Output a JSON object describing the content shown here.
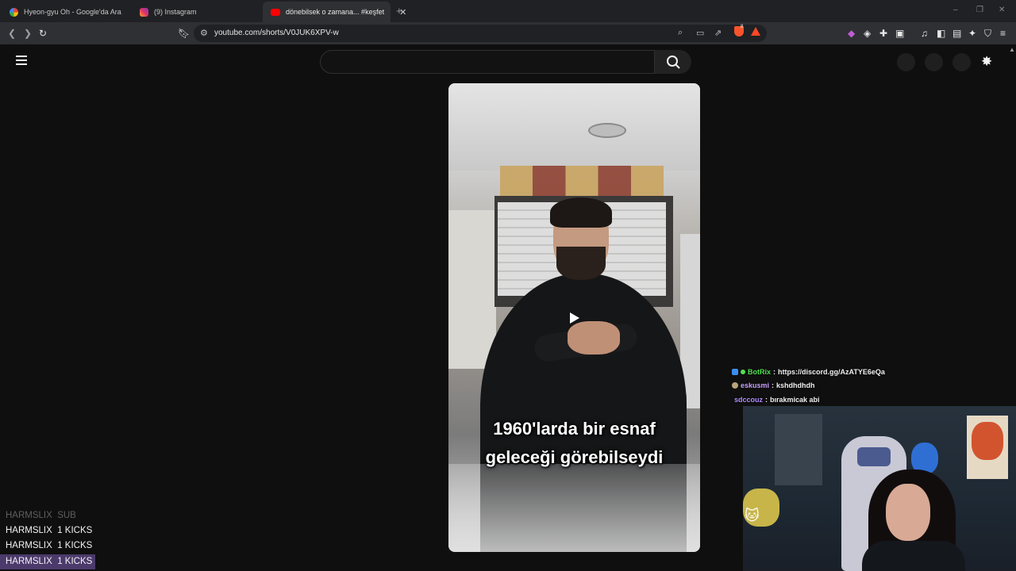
{
  "browser": {
    "tabs": [
      {
        "title": "Hyeon-gyu Oh - Google'da Ara",
        "icon": "google-icon",
        "active": false
      },
      {
        "title": "(9) Instagram",
        "icon": "instagram-icon",
        "active": false
      },
      {
        "title": "dönebilsek o zamana... #keşfet",
        "icon": "youtube-icon",
        "active": true
      }
    ],
    "new_tab": "+",
    "url": "youtube.com/shorts/V0JUK6XPV-w",
    "window_controls": [
      "–",
      "❐",
      "✕"
    ],
    "brave_badge": "8"
  },
  "youtube": {
    "search_placeholder": "",
    "video": {
      "caption_line1": "1960'larda bir esnaf",
      "caption_line2": "geleceği görebilseydi"
    }
  },
  "stream": {
    "chat": [
      {
        "user": "BotRix",
        "message": "https://discord.gg/AzATYE6eQa",
        "user_color": "#52e052",
        "badge_color": "#3a8ef0"
      },
      {
        "user": "eskusmi",
        "message": "kshdhdhdh",
        "user_color": "#c8a0ff",
        "badge_color": "#b8a47a"
      },
      {
        "user": "sdccouz",
        "message": "bırakmicak abi",
        "user_color": "#b08cff",
        "badge_color": ""
      }
    ],
    "alerts": [
      {
        "user": "HARMSLIX",
        "text": "SUB"
      },
      {
        "user": "HARMSLIX",
        "text": "1 KICKS"
      },
      {
        "user": "HARMSLIX",
        "text": "1 KICKS"
      },
      {
        "user": "HARMSLIX",
        "text": "1 KICKS"
      }
    ]
  }
}
